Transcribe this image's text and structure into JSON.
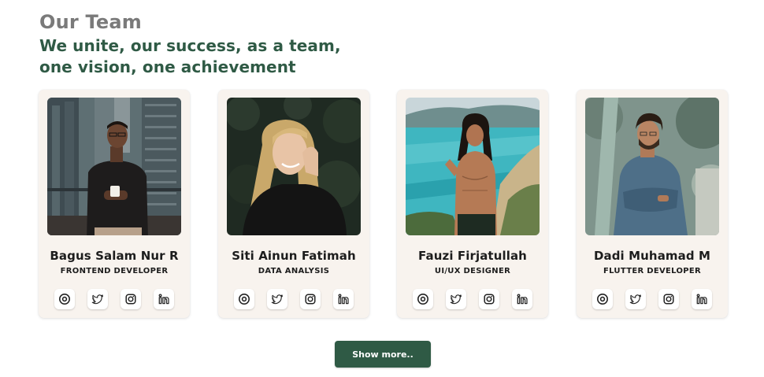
{
  "header": {
    "section_label": "Our Team",
    "headline_line1": "We unite, our success, as a team,",
    "headline_line2": "one vision, one achievement"
  },
  "colors": {
    "accent": "#2f5a45",
    "card_background": "#f8f3ee",
    "label_gray": "#7a7a7a"
  },
  "members": [
    {
      "name": "Bagus Salam Nur R",
      "role": "FRONTEND DEVELOPER",
      "photo": "man-on-balcony-holding-cup"
    },
    {
      "name": "Siti Ainun Fatimah",
      "role": "DATA ANALYSIS",
      "photo": "smiling-blonde-woman-dark-foliage"
    },
    {
      "name": "Fauzi Firjatullah",
      "role": "UI/UX DESIGNER",
      "photo": "shirtless-man-by-the-sea"
    },
    {
      "name": "Dadi Muhamad M",
      "role": "FLUTTER DEVELOPER",
      "photo": "bearded-man-arms-crossed-outdoors"
    }
  ],
  "social_icons": [
    "dribbble-icon",
    "twitter-icon",
    "instagram-icon",
    "linkedin-icon"
  ],
  "show_more": {
    "label": "Show more.."
  }
}
